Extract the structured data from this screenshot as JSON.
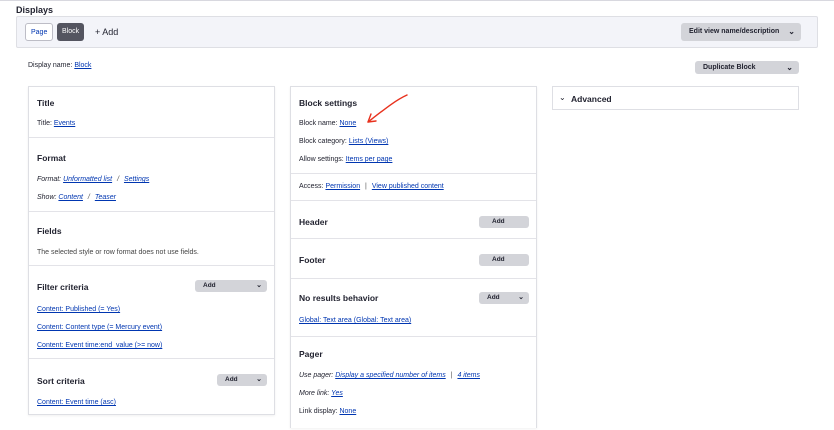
{
  "header": {
    "title": "Displays"
  },
  "tabs": {
    "page": "Page",
    "block": "Block",
    "add": "+ Add"
  },
  "buttons": {
    "edit_view": "Edit view name/description",
    "duplicate": "Duplicate Block",
    "add": "Add"
  },
  "display_name": {
    "label": "Display name:",
    "value": "Block"
  },
  "left": {
    "title": {
      "heading": "Title",
      "label": "Title:",
      "value": "Events"
    },
    "format": {
      "heading": "Format",
      "format_label": "Format:",
      "format_value": "Unformatted list",
      "settings": "Settings",
      "show_label": "Show:",
      "show_value": "Content",
      "teaser": "Teaser",
      "slash": "/"
    },
    "fields": {
      "heading": "Fields",
      "text": "The selected style or row format does not use fields."
    },
    "filter": {
      "heading": "Filter criteria",
      "items": [
        "Content: Published (= Yes)",
        "Content: Content type (= Mercury event)",
        "Content: Event time:end_value (>= now)"
      ]
    },
    "sort": {
      "heading": "Sort criteria",
      "items": [
        "Content: Event time (asc)"
      ]
    }
  },
  "middle": {
    "block_settings": {
      "heading": "Block settings",
      "name_label": "Block name:",
      "name_value": "None",
      "category_label": "Block category:",
      "category_value": "Lists (Views)",
      "allow_label": "Allow settings:",
      "allow_value": "Items per page",
      "access_label": "Access:",
      "access_value": "Permission",
      "access_sep": "|",
      "access_value2": "View published content"
    },
    "header_sec": {
      "heading": "Header"
    },
    "footer_sec": {
      "heading": "Footer"
    },
    "no_results": {
      "heading": "No results behavior",
      "items": [
        "Global: Text area (Global: Text area)"
      ]
    },
    "pager": {
      "heading": "Pager",
      "use_label": "Use pager:",
      "use_value": "Display a specified number of items",
      "sep": "|",
      "count": "4 items",
      "more_label": "More link:",
      "more_value": "Yes",
      "link_label": "Link display:",
      "link_value": "None"
    }
  },
  "right": {
    "advanced": "Advanced"
  },
  "colors": {
    "link": "#0036b1",
    "active_tab": "#545560",
    "annotation": "#e8311d"
  }
}
